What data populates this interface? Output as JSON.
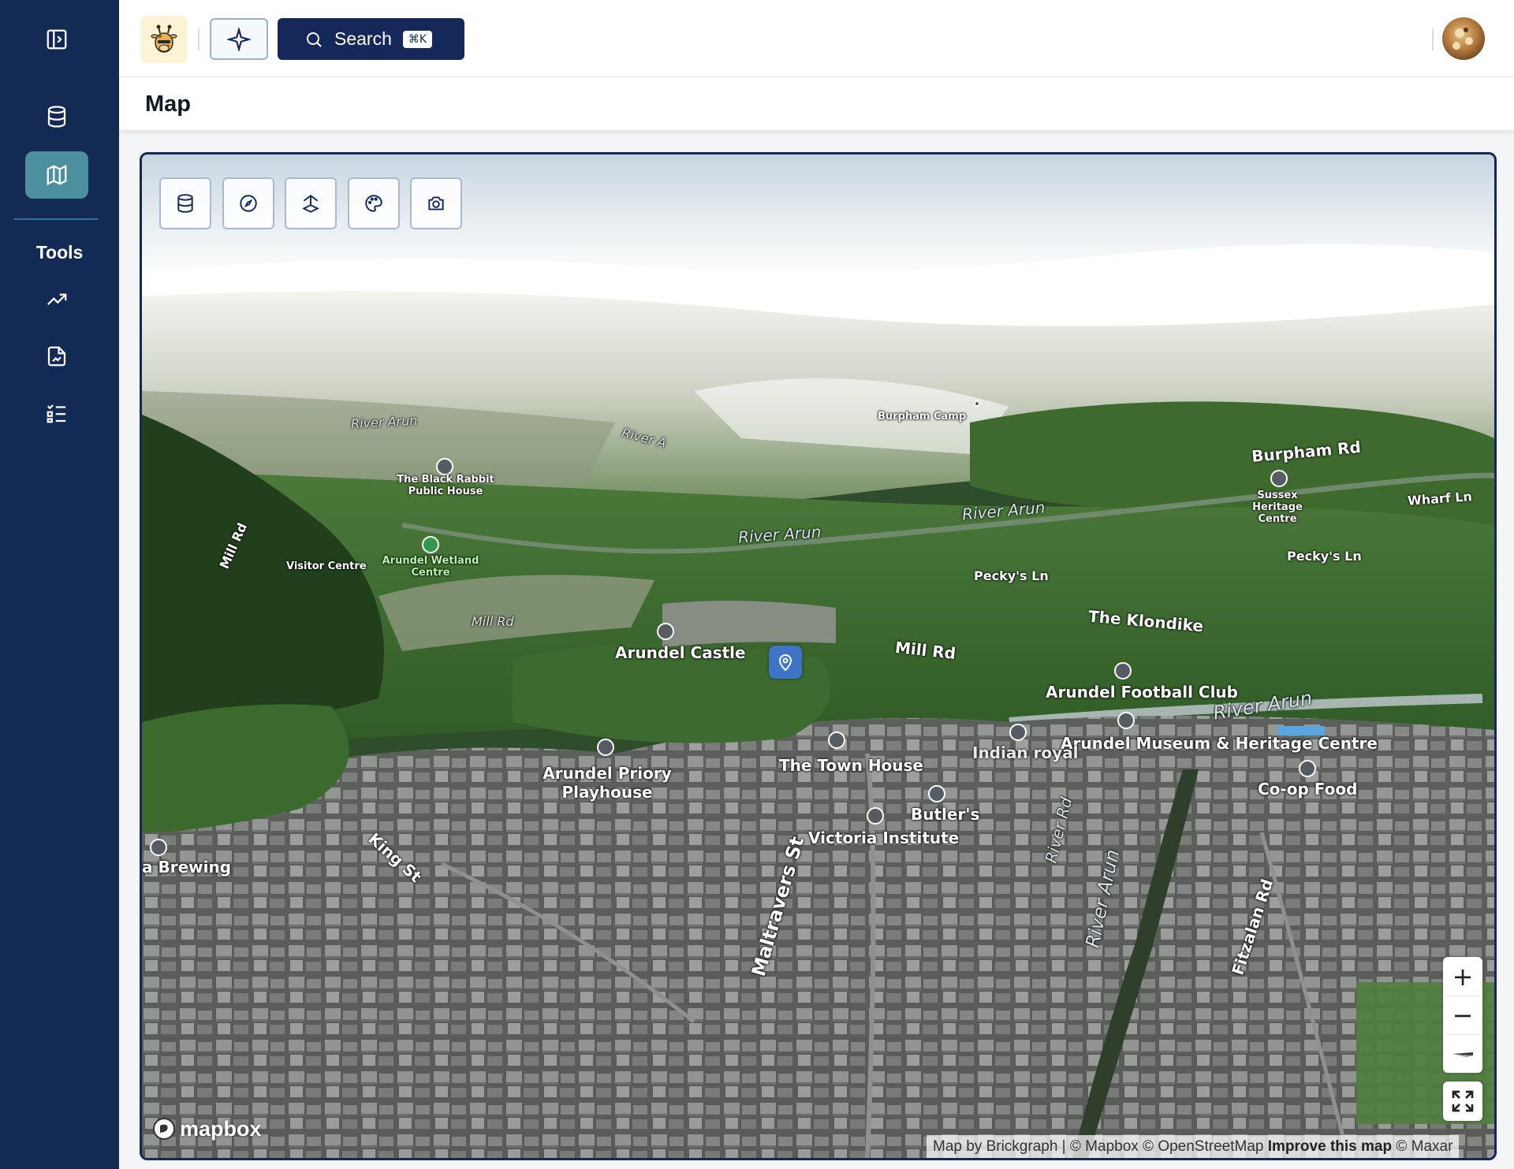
{
  "sidebar": {
    "tools_label": "Tools",
    "items": [
      {
        "icon": "panel-toggle-icon"
      },
      {
        "icon": "database-icon"
      },
      {
        "icon": "map-icon",
        "active": true
      },
      {
        "icon": "trending-up-icon"
      },
      {
        "icon": "file-chart-icon"
      },
      {
        "icon": "checklist-icon"
      }
    ]
  },
  "topbar": {
    "logo_icon": "giraffe-logo-icon",
    "sparkle_icon": "sparkle-icon",
    "search_label": "Search",
    "search_shortcut": "⌘K"
  },
  "page": {
    "title": "Map"
  },
  "map": {
    "toolbar": [
      "database-icon",
      "compass-icon",
      "terrain-icon",
      "palette-icon",
      "camera-icon"
    ],
    "labels": {
      "river_arun_1": "River Arun",
      "river_arun_2": "River A",
      "river_arun_3": "River Arun",
      "river_arun_4": "River Arun",
      "river_arun_5": "River Arun",
      "river_arun_6": "River Arun",
      "burpham_camp": "Burpham Camp",
      "burpham_rd": "Burpham Rd",
      "sussex_heritage": "Sussex Heritage Centre",
      "wharf_ln": "Wharf Ln",
      "black_rabbit": "The Black Rabbit Public House",
      "mill_rd_1": "Mill Rd",
      "mill_rd_2": "Mill Rd",
      "mill_rd_3": "Mill Rd",
      "visitor_centre": "Visitor Centre",
      "wetland_centre": "Arundel Wetland Centre",
      "peckys_ln_1": "Pecky's Ln",
      "peckys_ln_2": "Pecky's Ln",
      "the_klondike": "The Klondike",
      "arundel_castle": "Arundel Castle",
      "football_club": "Arundel Football Club",
      "arundel_museum": "Arundel Museum & Heritage Centre",
      "indian_royal": "Indian royal",
      "town_house": "The Town House",
      "priory_playhouse": "Arundel Priory Playhouse",
      "coop_food": "Co-op Food",
      "butlers": "Butler's",
      "victoria_institute": "Victoria Institute",
      "brewing": "a Brewing",
      "king_st": "King St",
      "maltravers_st": "Maltravers St",
      "river_rd": "River Rd",
      "fitzalan_rd": "Fitzalan Rd"
    },
    "controls": {
      "zoom_in": "+",
      "zoom_out": "−"
    },
    "logo_text": "mapbox",
    "attribution": {
      "main": "Map by Brickgraph | © Mapbox © OpenStreetMap",
      "improve": "Improve this map",
      "maxar": "© Maxar"
    }
  }
}
